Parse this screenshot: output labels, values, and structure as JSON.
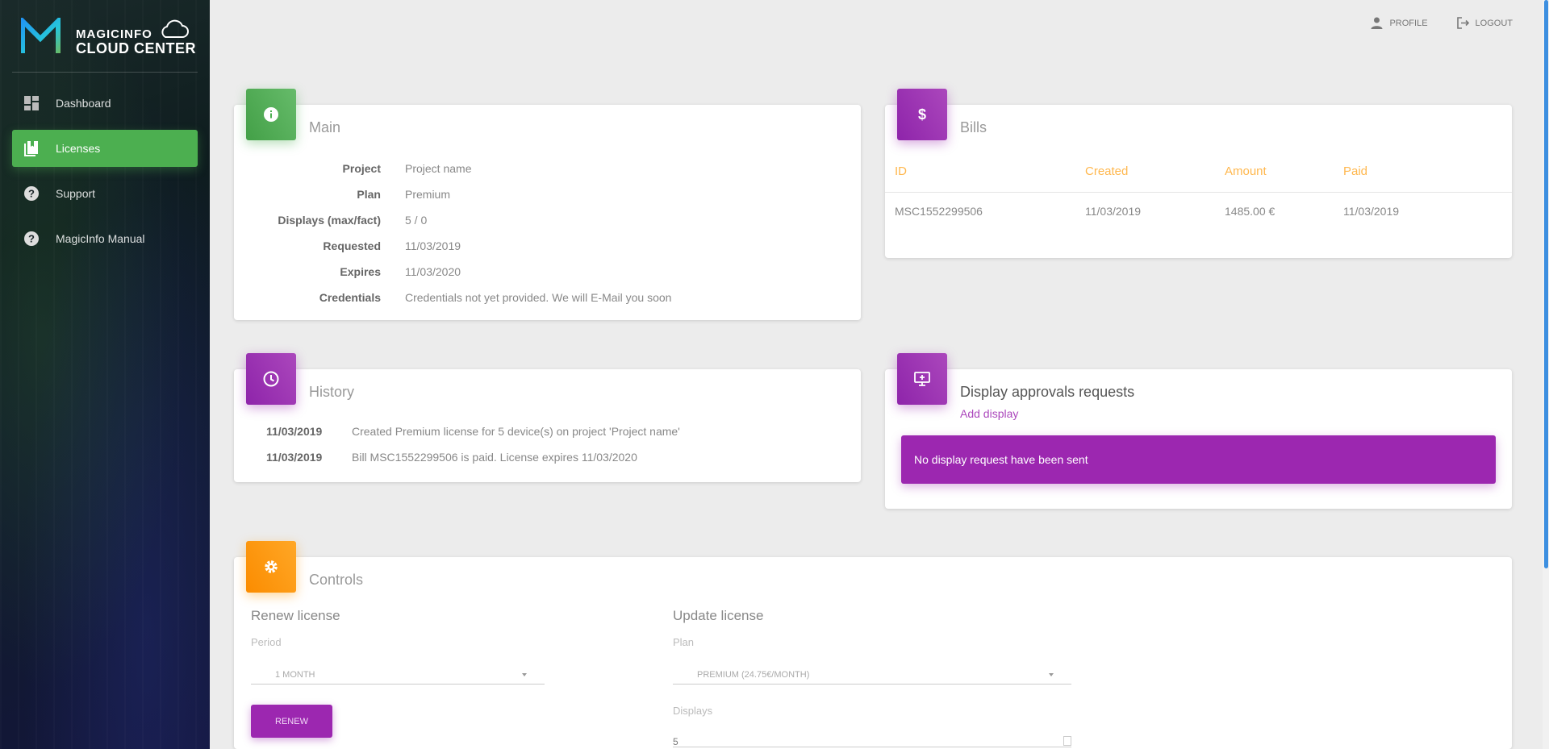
{
  "brand": {
    "line1": "MAGICINFO",
    "line2": "CLOUD CENTER"
  },
  "nav": [
    {
      "label": "Dashboard",
      "icon": "dashboard-icon",
      "active": false
    },
    {
      "label": "Licenses",
      "icon": "book-icon",
      "active": true
    },
    {
      "label": "Support",
      "icon": "help-circle-icon",
      "active": false
    },
    {
      "label": "MagicInfo Manual",
      "icon": "help-circle-icon",
      "active": false
    }
  ],
  "topbar": {
    "profile": "PROFILE",
    "logout": "LOGOUT"
  },
  "main_card": {
    "title": "Main",
    "rows": [
      {
        "label": "Project",
        "value": "Project name"
      },
      {
        "label": "Plan",
        "value": "Premium"
      },
      {
        "label": "Displays (max/fact)",
        "value": "5 / 0"
      },
      {
        "label": "Requested",
        "value": "11/03/2019"
      },
      {
        "label": "Expires",
        "value": "11/03/2020"
      },
      {
        "label": "Credentials",
        "value": "Credentials not yet provided. We will E-Mail you soon"
      }
    ]
  },
  "bills_card": {
    "title": "Bills",
    "columns": [
      "ID",
      "Created",
      "Amount",
      "Paid"
    ],
    "rows": [
      [
        "MSC1552299506",
        "11/03/2019",
        "1485.00 €",
        "11/03/2019"
      ]
    ]
  },
  "history_card": {
    "title": "History",
    "rows": [
      {
        "date": "11/03/2019",
        "text": "Created Premium license for 5 device(s) on project 'Project name'"
      },
      {
        "date": "11/03/2019",
        "text": "Bill MSC1552299506 is paid. License expires 11/03/2020"
      }
    ]
  },
  "display_card": {
    "title": "Display approvals requests",
    "add_link": "Add display",
    "alert": "No display request have been sent"
  },
  "controls_card": {
    "title": "Controls",
    "renew": {
      "title": "Renew license",
      "period_label": "Period",
      "period_value": "1 MONTH",
      "button": "RENEW"
    },
    "update": {
      "title": "Update license",
      "plan_label": "Plan",
      "plan_value": "PREMIUM (24.75€/MONTH)",
      "displays_label": "Displays",
      "displays_value": "5"
    }
  },
  "colors": {
    "green": "#4caf50",
    "purple": "#9c27b0",
    "orange": "#ff9800",
    "bills_header": "#ffb74d"
  }
}
